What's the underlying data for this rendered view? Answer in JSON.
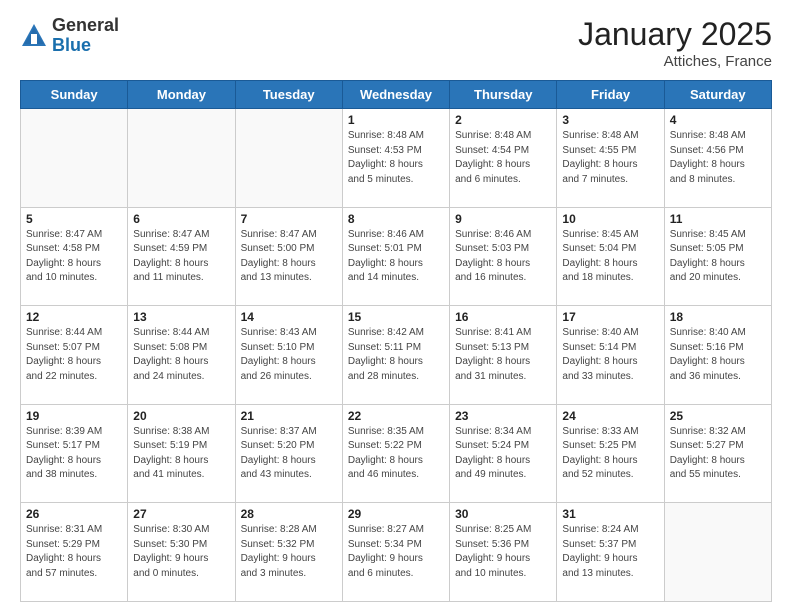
{
  "header": {
    "logo_general": "General",
    "logo_blue": "Blue",
    "title": "January 2025",
    "subtitle": "Attiches, France"
  },
  "weekdays": [
    "Sunday",
    "Monday",
    "Tuesday",
    "Wednesday",
    "Thursday",
    "Friday",
    "Saturday"
  ],
  "weeks": [
    [
      {
        "day": "",
        "info": ""
      },
      {
        "day": "",
        "info": ""
      },
      {
        "day": "",
        "info": ""
      },
      {
        "day": "1",
        "info": "Sunrise: 8:48 AM\nSunset: 4:53 PM\nDaylight: 8 hours\nand 5 minutes."
      },
      {
        "day": "2",
        "info": "Sunrise: 8:48 AM\nSunset: 4:54 PM\nDaylight: 8 hours\nand 6 minutes."
      },
      {
        "day": "3",
        "info": "Sunrise: 8:48 AM\nSunset: 4:55 PM\nDaylight: 8 hours\nand 7 minutes."
      },
      {
        "day": "4",
        "info": "Sunrise: 8:48 AM\nSunset: 4:56 PM\nDaylight: 8 hours\nand 8 minutes."
      }
    ],
    [
      {
        "day": "5",
        "info": "Sunrise: 8:47 AM\nSunset: 4:58 PM\nDaylight: 8 hours\nand 10 minutes."
      },
      {
        "day": "6",
        "info": "Sunrise: 8:47 AM\nSunset: 4:59 PM\nDaylight: 8 hours\nand 11 minutes."
      },
      {
        "day": "7",
        "info": "Sunrise: 8:47 AM\nSunset: 5:00 PM\nDaylight: 8 hours\nand 13 minutes."
      },
      {
        "day": "8",
        "info": "Sunrise: 8:46 AM\nSunset: 5:01 PM\nDaylight: 8 hours\nand 14 minutes."
      },
      {
        "day": "9",
        "info": "Sunrise: 8:46 AM\nSunset: 5:03 PM\nDaylight: 8 hours\nand 16 minutes."
      },
      {
        "day": "10",
        "info": "Sunrise: 8:45 AM\nSunset: 5:04 PM\nDaylight: 8 hours\nand 18 minutes."
      },
      {
        "day": "11",
        "info": "Sunrise: 8:45 AM\nSunset: 5:05 PM\nDaylight: 8 hours\nand 20 minutes."
      }
    ],
    [
      {
        "day": "12",
        "info": "Sunrise: 8:44 AM\nSunset: 5:07 PM\nDaylight: 8 hours\nand 22 minutes."
      },
      {
        "day": "13",
        "info": "Sunrise: 8:44 AM\nSunset: 5:08 PM\nDaylight: 8 hours\nand 24 minutes."
      },
      {
        "day": "14",
        "info": "Sunrise: 8:43 AM\nSunset: 5:10 PM\nDaylight: 8 hours\nand 26 minutes."
      },
      {
        "day": "15",
        "info": "Sunrise: 8:42 AM\nSunset: 5:11 PM\nDaylight: 8 hours\nand 28 minutes."
      },
      {
        "day": "16",
        "info": "Sunrise: 8:41 AM\nSunset: 5:13 PM\nDaylight: 8 hours\nand 31 minutes."
      },
      {
        "day": "17",
        "info": "Sunrise: 8:40 AM\nSunset: 5:14 PM\nDaylight: 8 hours\nand 33 minutes."
      },
      {
        "day": "18",
        "info": "Sunrise: 8:40 AM\nSunset: 5:16 PM\nDaylight: 8 hours\nand 36 minutes."
      }
    ],
    [
      {
        "day": "19",
        "info": "Sunrise: 8:39 AM\nSunset: 5:17 PM\nDaylight: 8 hours\nand 38 minutes."
      },
      {
        "day": "20",
        "info": "Sunrise: 8:38 AM\nSunset: 5:19 PM\nDaylight: 8 hours\nand 41 minutes."
      },
      {
        "day": "21",
        "info": "Sunrise: 8:37 AM\nSunset: 5:20 PM\nDaylight: 8 hours\nand 43 minutes."
      },
      {
        "day": "22",
        "info": "Sunrise: 8:35 AM\nSunset: 5:22 PM\nDaylight: 8 hours\nand 46 minutes."
      },
      {
        "day": "23",
        "info": "Sunrise: 8:34 AM\nSunset: 5:24 PM\nDaylight: 8 hours\nand 49 minutes."
      },
      {
        "day": "24",
        "info": "Sunrise: 8:33 AM\nSunset: 5:25 PM\nDaylight: 8 hours\nand 52 minutes."
      },
      {
        "day": "25",
        "info": "Sunrise: 8:32 AM\nSunset: 5:27 PM\nDaylight: 8 hours\nand 55 minutes."
      }
    ],
    [
      {
        "day": "26",
        "info": "Sunrise: 8:31 AM\nSunset: 5:29 PM\nDaylight: 8 hours\nand 57 minutes."
      },
      {
        "day": "27",
        "info": "Sunrise: 8:30 AM\nSunset: 5:30 PM\nDaylight: 9 hours\nand 0 minutes."
      },
      {
        "day": "28",
        "info": "Sunrise: 8:28 AM\nSunset: 5:32 PM\nDaylight: 9 hours\nand 3 minutes."
      },
      {
        "day": "29",
        "info": "Sunrise: 8:27 AM\nSunset: 5:34 PM\nDaylight: 9 hours\nand 6 minutes."
      },
      {
        "day": "30",
        "info": "Sunrise: 8:25 AM\nSunset: 5:36 PM\nDaylight: 9 hours\nand 10 minutes."
      },
      {
        "day": "31",
        "info": "Sunrise: 8:24 AM\nSunset: 5:37 PM\nDaylight: 9 hours\nand 13 minutes."
      },
      {
        "day": "",
        "info": ""
      }
    ]
  ]
}
